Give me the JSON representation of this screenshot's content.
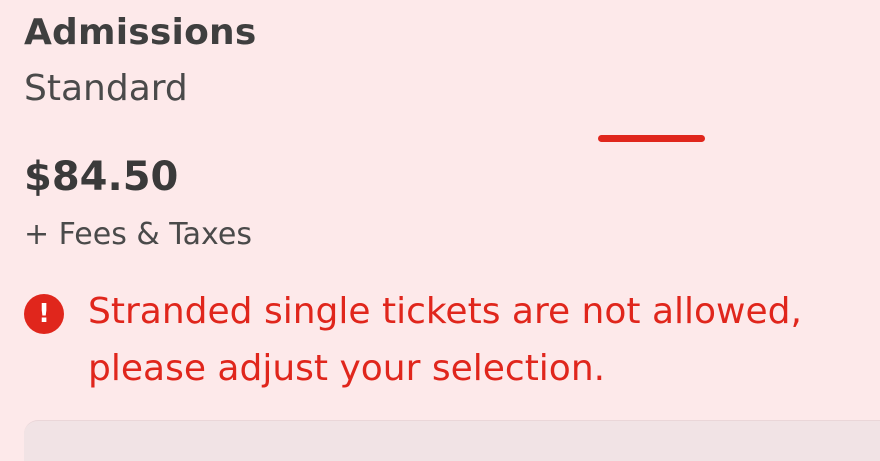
{
  "ticket": {
    "name": "Admissions",
    "type": "Standard",
    "price": "$84.50",
    "fees_note": "+ Fees & Taxes"
  },
  "error": {
    "icon": "exclamation-circle-icon",
    "icon_glyph": "!",
    "message": "Stranded single tickets are not allowed, please adjust your selection."
  },
  "colors": {
    "background": "#fde9ea",
    "error": "#e0261c",
    "text_primary": "#3f3f3f"
  }
}
